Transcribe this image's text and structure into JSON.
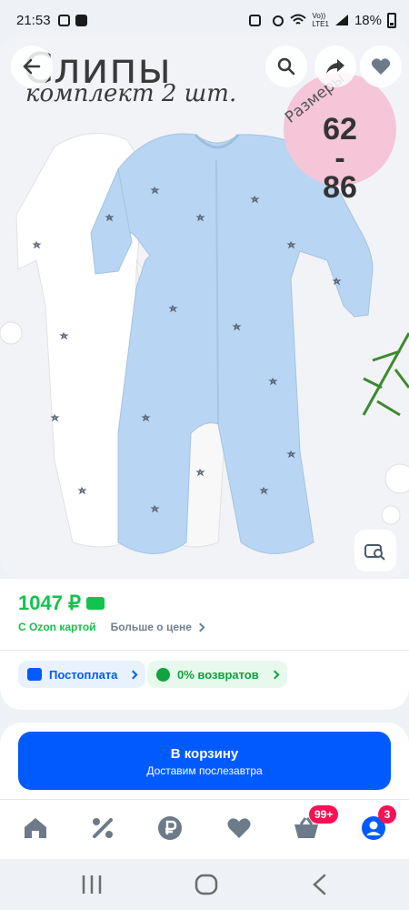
{
  "status_bar": {
    "time": "21:53",
    "signal_text": "Vo))\nLTE1",
    "battery": "18%"
  },
  "product_image": {
    "title": "Слипы",
    "subtitle": "комплект 2 шт.",
    "size_label": "Размеры",
    "size_value": "62\n-\n86"
  },
  "price": {
    "value": "1047 ₽",
    "ozon_card_label": "С Ozon картой",
    "more_about_price": "Больше о цене"
  },
  "chips": {
    "postpay": "Постоплата",
    "returns": "0% возвратов"
  },
  "cart": {
    "title": "В корзину",
    "subtitle": "Доставим послезавтра"
  },
  "nav": {
    "cart_badge": "99+",
    "profile_badge": "3"
  },
  "colors": {
    "accent_blue": "#005bff",
    "price_green": "#10c44c",
    "badge_pink": "#f91155",
    "romper_blue": "#b8d5f3"
  },
  "icons": {
    "toolbar": [
      "back-arrow-icon",
      "search-icon",
      "share-icon",
      "heart-icon"
    ],
    "nav": [
      "home-icon",
      "percent-icon",
      "ruble-icon",
      "heart-icon",
      "cart-icon",
      "profile-icon"
    ]
  }
}
